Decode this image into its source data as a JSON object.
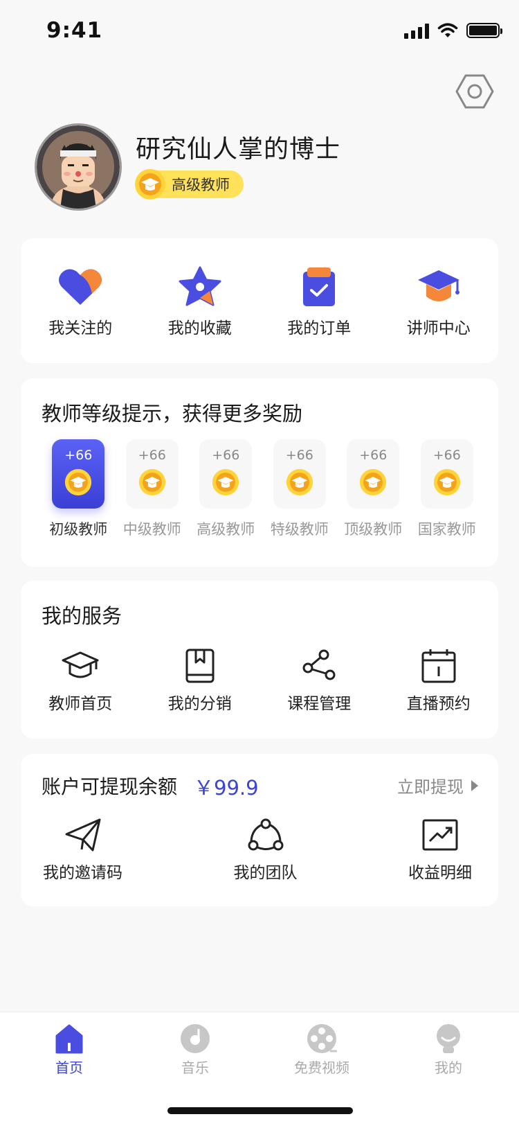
{
  "status": {
    "time": "9:41"
  },
  "profile": {
    "name": "研究仙人掌的博士",
    "level": "高级教师"
  },
  "quick": [
    {
      "label": "我关注的",
      "icon": "heart-icon"
    },
    {
      "label": "我的收藏",
      "icon": "star-icon"
    },
    {
      "label": "我的订单",
      "icon": "clipboard-check-icon"
    },
    {
      "label": "讲师中心",
      "icon": "graduation-cap-icon"
    }
  ],
  "levels": {
    "title": "教师等级提示，获得更多奖励",
    "items": [
      {
        "name": "初级教师",
        "bonus": "+66",
        "active": true
      },
      {
        "name": "中级教师",
        "bonus": "+66"
      },
      {
        "name": "高级教师",
        "bonus": "+66"
      },
      {
        "name": "特级教师",
        "bonus": "+66"
      },
      {
        "name": "顶级教师",
        "bonus": "+66"
      },
      {
        "name": "国家教师",
        "bonus": "+66"
      }
    ]
  },
  "services": {
    "title": "我的服务",
    "items": [
      {
        "label": "教师首页",
        "icon": "mortarboard-outline-icon"
      },
      {
        "label": "我的分销",
        "icon": "book-outline-icon"
      },
      {
        "label": "课程管理",
        "icon": "share-nodes-icon"
      },
      {
        "label": "直播预约",
        "icon": "calendar-icon"
      }
    ]
  },
  "account": {
    "label": "账户可提现余额",
    "balance": "￥99.9",
    "withdraw": "立即提现",
    "items": [
      {
        "label": "我的邀请码",
        "icon": "paper-plane-icon"
      },
      {
        "label": "我的团队",
        "icon": "team-network-icon"
      },
      {
        "label": "收益明细",
        "icon": "trend-chart-icon"
      }
    ]
  },
  "tabs": [
    {
      "label": "首页",
      "icon": "home-icon",
      "active": true
    },
    {
      "label": "音乐",
      "icon": "music-disc-icon"
    },
    {
      "label": "免费视频",
      "icon": "film-reel-icon"
    },
    {
      "label": "我的",
      "icon": "user-icon"
    }
  ],
  "colors": {
    "accent": "#3a44d8",
    "orange": "#f5873a",
    "gold": "#ffd43b"
  }
}
